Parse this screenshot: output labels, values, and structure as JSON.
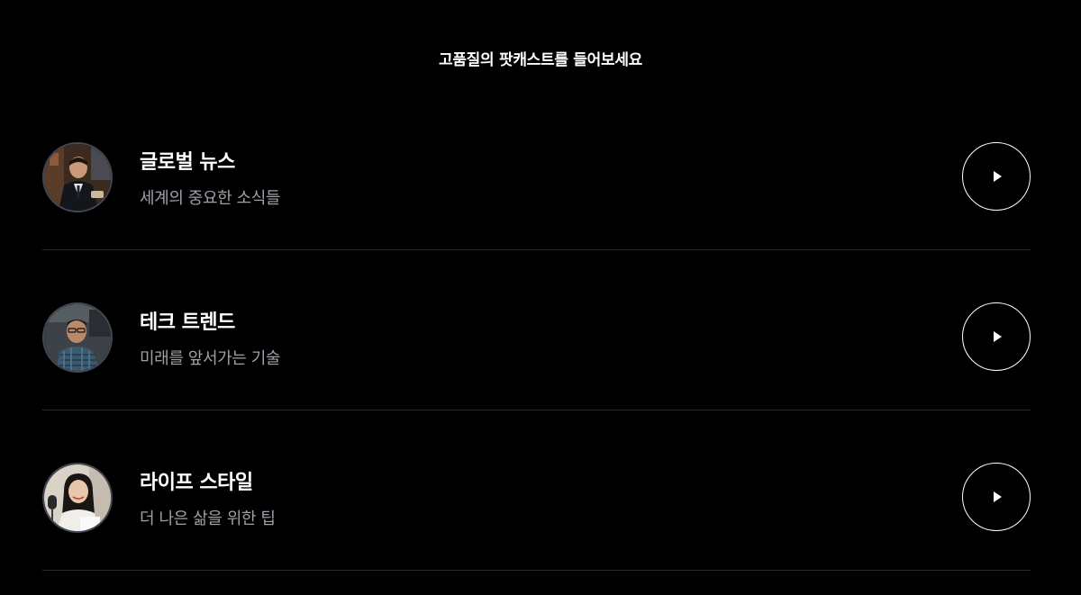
{
  "header": {
    "title": "고품질의 팟캐스트를 들어보세요"
  },
  "podcasts": [
    {
      "title": "글로벌 뉴스",
      "subtitle": "세계의 중요한 소식들",
      "avatar": "host-photo-man-suit",
      "action_icon": "play-icon"
    },
    {
      "title": "테크 트렌드",
      "subtitle": "미래를 앞서가는 기술",
      "avatar": "host-photo-man-glasses",
      "action_icon": "play-icon"
    },
    {
      "title": "라이프 스타일",
      "subtitle": "더 나은 삶을 위한 팁",
      "avatar": "host-photo-woman-microphone",
      "action_icon": "play-icon"
    }
  ],
  "colors": {
    "background": "#000000",
    "title": "#ffffff",
    "subtitle": "#9ca0a8",
    "divider": "#262a31",
    "avatar_ring": "#414753"
  }
}
